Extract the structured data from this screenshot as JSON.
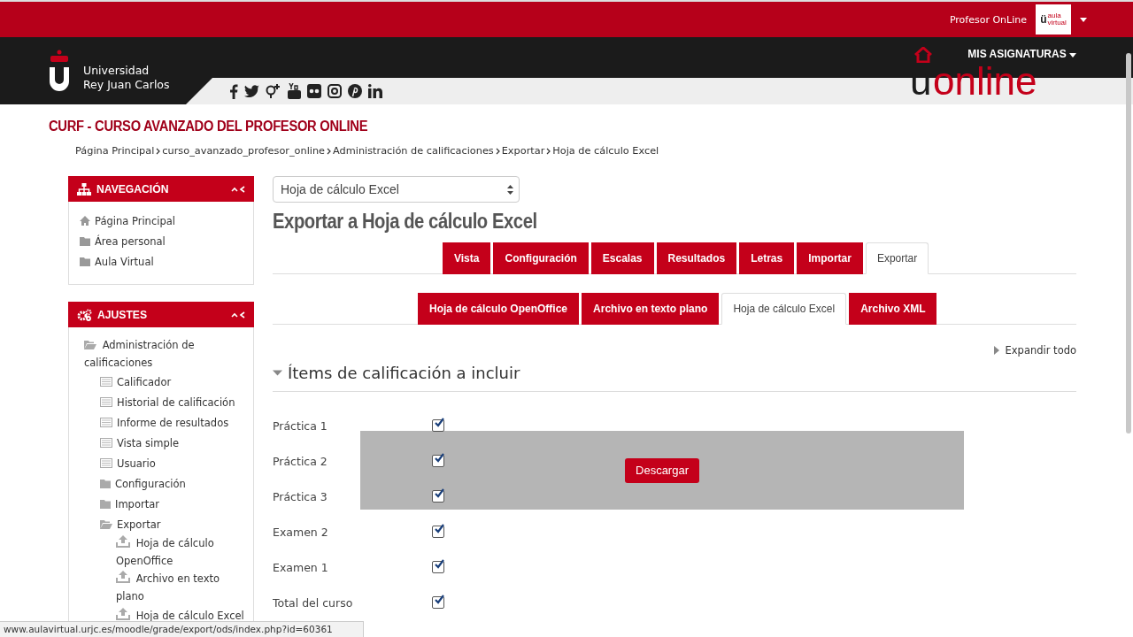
{
  "topbar": {
    "user": "Profesor OnLine",
    "logo_letter": "ü",
    "logo_text": "aula",
    "logo_sub": "virtual"
  },
  "header": {
    "university_line1": "Universidad",
    "university_line2": "Rey Juan Carlos",
    "menu": "MIS ASIGNATURAS",
    "brand_u": "u",
    "brand_online": "online"
  },
  "course_title": "CURF - CURSO AVANZADO DEL PROFESOR ONLINE",
  "breadcrumb": [
    "Página Principal",
    "curso_avanzado_profesor_online",
    "Administración de calificaciones",
    "Exportar",
    "Hoja de cálculo Excel"
  ],
  "navigation": {
    "title": "NAVEGACIÓN",
    "items": [
      {
        "label": "Página Principal",
        "kind": "home"
      },
      {
        "label": "Área personal",
        "kind": "folder"
      },
      {
        "label": "Aula Virtual",
        "kind": "folder"
      }
    ]
  },
  "settings": {
    "title": "AJUSTES",
    "items": [
      {
        "label": "Administración de calificaciones",
        "kind": "folder",
        "expanded": true,
        "children": [
          {
            "label": "Calificador",
            "kind": "report"
          },
          {
            "label": "Historial de calificación",
            "kind": "report"
          },
          {
            "label": "Informe de resultados",
            "kind": "report"
          },
          {
            "label": "Vista simple",
            "kind": "report"
          },
          {
            "label": "Usuario",
            "kind": "report"
          },
          {
            "label": "Configuración",
            "kind": "folder",
            "expanded": false
          },
          {
            "label": "Importar",
            "kind": "folder",
            "expanded": false
          },
          {
            "label": "Exportar",
            "kind": "folder",
            "expanded": true,
            "children": [
              {
                "label": "Hoja de cálculo OpenOffice",
                "kind": "export"
              },
              {
                "label": "Archivo en texto plano",
                "kind": "export"
              },
              {
                "label": "Hoja de cálculo Excel",
                "kind": "export"
              }
            ]
          }
        ]
      }
    ]
  },
  "format_select": {
    "value": "Hoja de cálculo Excel"
  },
  "page_title": "Exportar a Hoja de cálculo Excel",
  "tabs": [
    {
      "label": "Vista",
      "selected": false
    },
    {
      "label": "Configuración",
      "selected": false
    },
    {
      "label": "Escalas",
      "selected": false
    },
    {
      "label": "Resultados",
      "selected": false
    },
    {
      "label": "Letras",
      "selected": false
    },
    {
      "label": "Importar",
      "selected": false
    },
    {
      "label": "Exportar",
      "selected": true
    }
  ],
  "subtabs": [
    {
      "label": "Hoja de cálculo OpenOffice",
      "selected": false
    },
    {
      "label": "Archivo en texto plano",
      "selected": false
    },
    {
      "label": "Hoja de cálculo Excel",
      "selected": true
    },
    {
      "label": "Archivo XML",
      "selected": false
    }
  ],
  "expand_all": "Expandir todo",
  "section": {
    "title": "Ítems de calificación a incluir",
    "expanded": true
  },
  "grade_items": [
    {
      "label": "Práctica 1",
      "checked": true
    },
    {
      "label": "Práctica 2",
      "checked": true
    },
    {
      "label": "Práctica 3",
      "checked": true
    },
    {
      "label": "Examen 2",
      "checked": true
    },
    {
      "label": "Examen 1",
      "checked": true
    },
    {
      "label": "Total del curso",
      "checked": true
    }
  ],
  "download_button": "Descargar",
  "status_url": "www.aulavirtual.urjc.es/moodle/grade/export/ods/index.php?id=60361"
}
